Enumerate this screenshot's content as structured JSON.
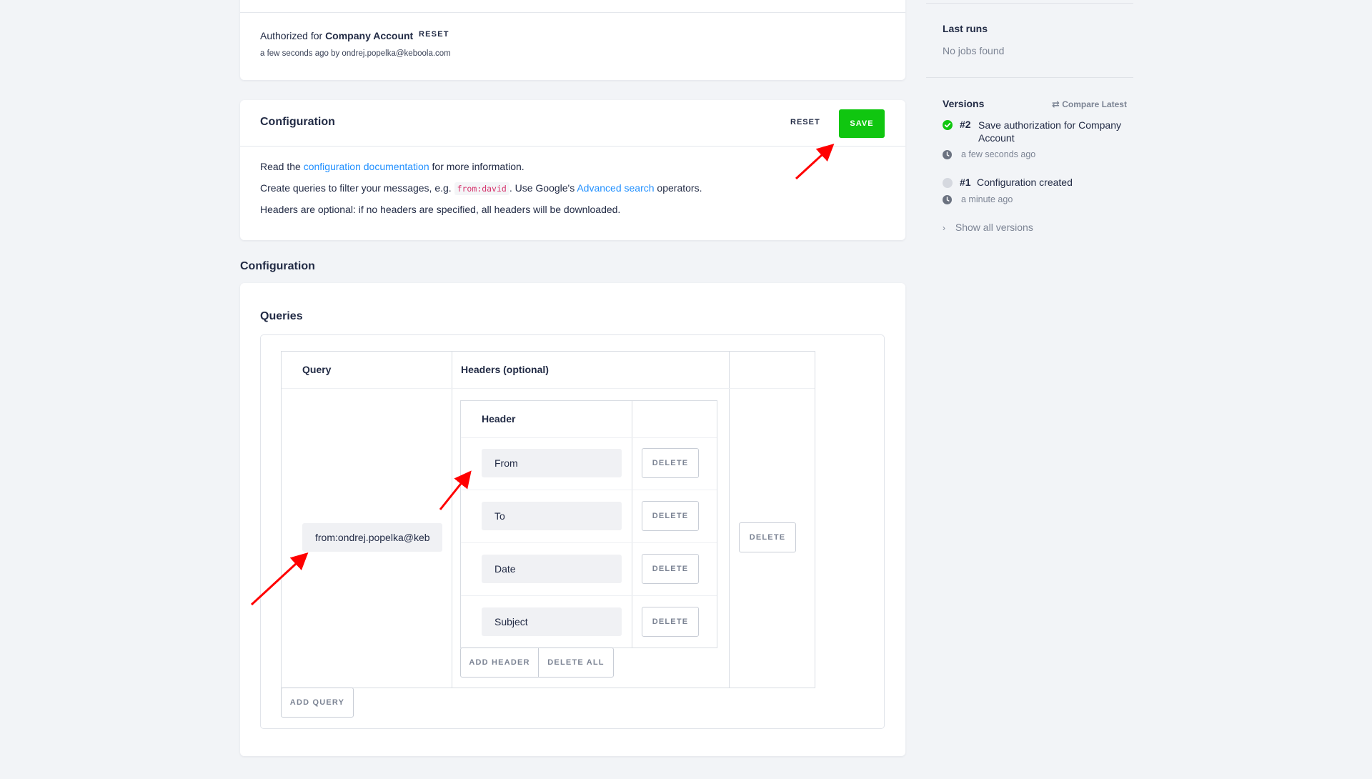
{
  "auth": {
    "authorized_prefix": "Authorized for",
    "account_name": "Company Account",
    "reset_label": "RESET",
    "meta": "a few seconds ago by ondrej.popelka@keboola.com"
  },
  "config_card": {
    "title": "Configuration",
    "reset_label": "RESET",
    "save_label": "SAVE",
    "line1_pre": "Read the",
    "line1_link": "configuration documentation",
    "line1_post": "for more information.",
    "line2_pre": "Create queries to filter your messages, e.g.",
    "line2_code": "from:david",
    "line2_mid": ". Use Google's",
    "line2_link": "Advanced search",
    "line2_post": "operators.",
    "line3": "Headers are optional: if no headers are specified, all headers will be downloaded."
  },
  "section_title": "Configuration",
  "queries": {
    "title": "Queries",
    "col_query": "Query",
    "col_headers": "Headers (optional)",
    "query_value": "from:ondrej.popelka@keb",
    "delete_query_label": "DELETE",
    "add_query_label": "ADD QUERY",
    "headers_table": {
      "col_header": "Header",
      "rows": [
        {
          "value": "From",
          "delete_label": "DELETE"
        },
        {
          "value": "To",
          "delete_label": "DELETE"
        },
        {
          "value": "Date",
          "delete_label": "DELETE"
        },
        {
          "value": "Subject",
          "delete_label": "DELETE"
        }
      ],
      "add_header_label": "ADD HEADER",
      "delete_all_label": "DELETE ALL"
    }
  },
  "sidebar": {
    "last_runs_title": "Last runs",
    "last_runs_empty": "No jobs found",
    "versions_title": "Versions",
    "compare_latest_label": "Compare Latest",
    "versions": [
      {
        "number": "#2",
        "text": "Save authorization for Company Account",
        "time": "a few seconds ago",
        "status": "success"
      },
      {
        "number": "#1",
        "text": "Configuration created",
        "time": "a minute ago",
        "status": "neutral"
      }
    ],
    "show_all_label": "Show all versions"
  },
  "colors": {
    "accent_green": "#10c610",
    "link_blue": "#1f8fff",
    "annotation_red": "#ff0000"
  }
}
